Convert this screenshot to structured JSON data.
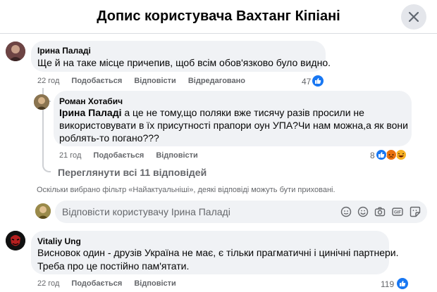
{
  "header": {
    "title": "Допис користувача Вахтанг Кіпіані"
  },
  "comments": [
    {
      "author": "Ірина Паладі",
      "text": "Ще й на таке місце причепив, щоб всім обов'язково було видно.",
      "time": "22 год",
      "like_label": "Подобається",
      "reply_label": "Відповісти",
      "edited_label": "Відредаговано",
      "reactions": "47"
    },
    {
      "author": "Роман Хотабич",
      "mention": "Ірина Паладі",
      "text_line1": " а це не тому,що поляки вже тисячу разів просили не",
      "text_line2": "використовувати в їх присутності прапори оун УПА?Чи нам можна,а як вони",
      "text_line3": "роблять-то погано???",
      "time": "21 год",
      "like_label": "Подобається",
      "reply_label": "Відповісти",
      "reactions": "8"
    },
    {
      "author": "Vitaliy Ung",
      "text_line1": "Висновок один - друзів Україна не має, є тільки прагматичні і цинічні партнери.",
      "text_line2": "Треба про це постійно пам'ятати.",
      "time": "22 год",
      "like_label": "Подобається",
      "reply_label": "Відповісти",
      "reactions": "119"
    }
  ],
  "view_replies": "Переглянути всі 11 відповідей",
  "filter_notice": "Оскільки вибрано фільтр «Найактуальніші», деякі відповіді можуть бути приховані.",
  "composer": {
    "placeholder": "Відповісти користувачу Ірина Паладі"
  },
  "colors": {
    "like_blue": "#1877f2",
    "bubble": "#f0f2f5",
    "secondary_text": "#65676b"
  }
}
